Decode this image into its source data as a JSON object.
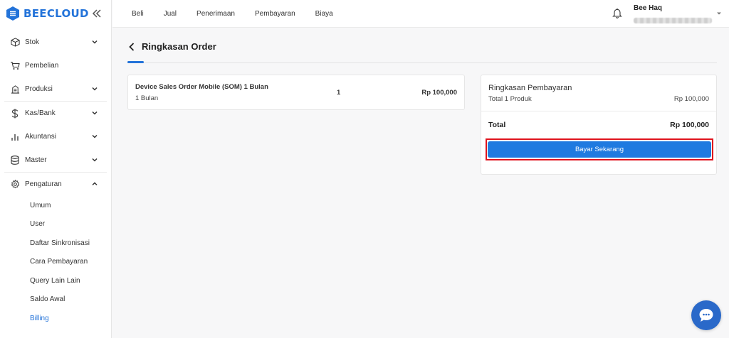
{
  "brand": {
    "name": "BEECLOUD",
    "color": "#2373d9"
  },
  "sidebar": {
    "collapse_icon": "double-chevron-left-icon",
    "items": [
      {
        "label": "Stok",
        "icon": "box-icon",
        "chevron": "down"
      },
      {
        "label": "Pembelian",
        "icon": "cart-icon",
        "chevron": ""
      },
      {
        "label": "Produksi",
        "icon": "factory-icon",
        "chevron": "down"
      },
      {
        "label": "Kas/Bank",
        "icon": "dollar-icon",
        "chevron": "down"
      },
      {
        "label": "Akuntansi",
        "icon": "bar-chart-icon",
        "chevron": "down"
      },
      {
        "label": "Master",
        "icon": "database-icon",
        "chevron": "down"
      },
      {
        "label": "Pengaturan",
        "icon": "gear-icon",
        "chevron": "up"
      }
    ],
    "subitems": [
      "Umum",
      "User",
      "Daftar Sinkronisasi",
      "Cara Pembayaran",
      "Query Lain Lain",
      "Saldo Awal",
      "Billing"
    ],
    "active_subitem": "Billing"
  },
  "topbar": {
    "nav": [
      "Beli",
      "Jual",
      "Penerimaan",
      "Pembayaran",
      "Biaya"
    ],
    "user_name": "Bee Haq"
  },
  "page": {
    "title": "Ringkasan Order"
  },
  "order": {
    "name": "Device Sales Order Mobile (SOM) 1 Bulan",
    "duration": "1 Bulan",
    "qty": "1",
    "price": "Rp 100,000"
  },
  "summary": {
    "title": "Ringkasan Pembayaran",
    "total_products_label": "Total 1 Produk",
    "total_products_value": "Rp 100,000",
    "total_label": "Total",
    "total_value": "Rp 100,000",
    "pay_button": "Bayar Sekarang"
  },
  "colors": {
    "accent": "#1f7ae0",
    "highlight": "#e0141e",
    "chat": "#2a69c9"
  }
}
